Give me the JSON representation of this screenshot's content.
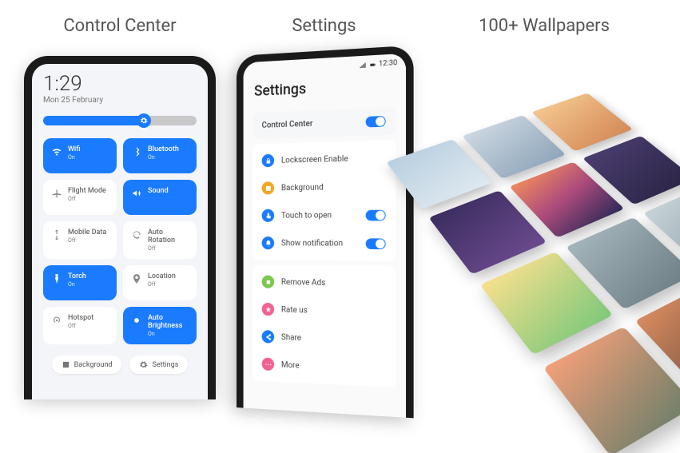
{
  "titles": {
    "col1": "Control Center",
    "col2": "Settings",
    "col3": "100+ Wallpapers"
  },
  "cc": {
    "time": "1:29",
    "date": "Mon 25 February",
    "tiles": [
      {
        "label": "Wifi",
        "status": "On",
        "on": true,
        "icon": "wifi"
      },
      {
        "label": "Bluetooth",
        "status": "On",
        "on": true,
        "icon": "bluetooth"
      },
      {
        "label": "Flight Mode",
        "status": "Off",
        "on": false,
        "icon": "plane"
      },
      {
        "label": "Sound",
        "status": "",
        "on": true,
        "icon": "sound"
      },
      {
        "label": "Mobile Data",
        "status": "Off",
        "on": false,
        "icon": "data"
      },
      {
        "label": "Auto Rotation",
        "status": "Off",
        "on": false,
        "icon": "rotate"
      },
      {
        "label": "Torch",
        "status": "On",
        "on": true,
        "icon": "torch"
      },
      {
        "label": "Location",
        "status": "Off",
        "on": false,
        "icon": "location"
      },
      {
        "label": "Hotspot",
        "status": "Off",
        "on": false,
        "icon": "hotspot"
      },
      {
        "label": "Auto Brightness",
        "status": "On",
        "on": true,
        "icon": "brightness"
      }
    ],
    "bottom": {
      "background": "Background",
      "settings": "Settings"
    }
  },
  "settings": {
    "statusTime": "12:30",
    "heading": "Settings",
    "main": {
      "label": "Control Center",
      "toggle": true
    },
    "group1": [
      {
        "label": "Lockscreen Enable",
        "color": "#1a7bff",
        "icon": "lock",
        "toggle": null
      },
      {
        "label": "Background",
        "color": "#f5a623",
        "icon": "image",
        "toggle": null
      },
      {
        "label": "Touch to open",
        "color": "#1a7bff",
        "icon": "touch",
        "toggle": true
      },
      {
        "label": "Show notification",
        "color": "#1a7bff",
        "icon": "bell",
        "toggle": true
      }
    ],
    "group2": [
      {
        "label": "Remove Ads",
        "color": "#7ac74f",
        "icon": "noads"
      },
      {
        "label": "Rate us",
        "color": "#f06292",
        "icon": "star"
      },
      {
        "label": "Share",
        "color": "#1a7bff",
        "icon": "share"
      },
      {
        "label": "More",
        "color": "#f06292",
        "icon": "more"
      }
    ]
  },
  "wallpapers": [
    "linear-gradient(160deg,#b8cfe0,#dfe9f0)",
    "linear-gradient(160deg,#cdd8e2,#8fa6ba)",
    "linear-gradient(160deg,#f4c78e,#d48a59)",
    "linear-gradient(160deg,#3a2d5e,#6b4a8e)",
    "linear-gradient(160deg,#f08a5d 0%,#ac4b7c 50%,#2e2a57 100%)",
    "linear-gradient(160deg,#4a3d70,#2b2545)",
    "linear-gradient(160deg,#f8e08e,#7fc97a)",
    "linear-gradient(160deg,#a4b5bc,#6e7f86)",
    "linear-gradient(160deg,#c7d4d9,#8a9ba3)",
    "linear-gradient(160deg,#f4a07a,#6e7f6a)",
    "linear-gradient(160deg,#d98b5f,#5e4637)",
    "radial-gradient(circle at 30% 30%,#f9d86b 0 18%,#4aa3df 18% 40%,#e85a71 40% 60%,#3ba37a 60% 100%)"
  ]
}
